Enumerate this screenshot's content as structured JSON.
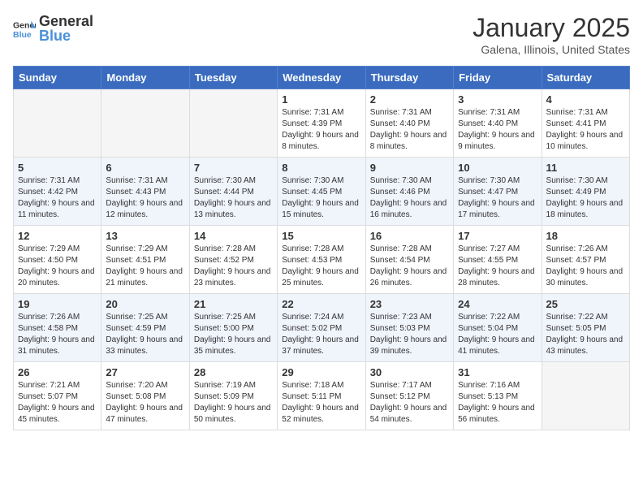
{
  "header": {
    "logo_general": "General",
    "logo_blue": "Blue",
    "month_title": "January 2025",
    "location": "Galena, Illinois, United States"
  },
  "weekdays": [
    "Sunday",
    "Monday",
    "Tuesday",
    "Wednesday",
    "Thursday",
    "Friday",
    "Saturday"
  ],
  "weeks": [
    [
      {
        "day": "",
        "info": ""
      },
      {
        "day": "",
        "info": ""
      },
      {
        "day": "",
        "info": ""
      },
      {
        "day": "1",
        "info": "Sunrise: 7:31 AM\nSunset: 4:39 PM\nDaylight: 9 hours and 8 minutes."
      },
      {
        "day": "2",
        "info": "Sunrise: 7:31 AM\nSunset: 4:40 PM\nDaylight: 9 hours and 8 minutes."
      },
      {
        "day": "3",
        "info": "Sunrise: 7:31 AM\nSunset: 4:40 PM\nDaylight: 9 hours and 9 minutes."
      },
      {
        "day": "4",
        "info": "Sunrise: 7:31 AM\nSunset: 4:41 PM\nDaylight: 9 hours and 10 minutes."
      }
    ],
    [
      {
        "day": "5",
        "info": "Sunrise: 7:31 AM\nSunset: 4:42 PM\nDaylight: 9 hours and 11 minutes."
      },
      {
        "day": "6",
        "info": "Sunrise: 7:31 AM\nSunset: 4:43 PM\nDaylight: 9 hours and 12 minutes."
      },
      {
        "day": "7",
        "info": "Sunrise: 7:30 AM\nSunset: 4:44 PM\nDaylight: 9 hours and 13 minutes."
      },
      {
        "day": "8",
        "info": "Sunrise: 7:30 AM\nSunset: 4:45 PM\nDaylight: 9 hours and 15 minutes."
      },
      {
        "day": "9",
        "info": "Sunrise: 7:30 AM\nSunset: 4:46 PM\nDaylight: 9 hours and 16 minutes."
      },
      {
        "day": "10",
        "info": "Sunrise: 7:30 AM\nSunset: 4:47 PM\nDaylight: 9 hours and 17 minutes."
      },
      {
        "day": "11",
        "info": "Sunrise: 7:30 AM\nSunset: 4:49 PM\nDaylight: 9 hours and 18 minutes."
      }
    ],
    [
      {
        "day": "12",
        "info": "Sunrise: 7:29 AM\nSunset: 4:50 PM\nDaylight: 9 hours and 20 minutes."
      },
      {
        "day": "13",
        "info": "Sunrise: 7:29 AM\nSunset: 4:51 PM\nDaylight: 9 hours and 21 minutes."
      },
      {
        "day": "14",
        "info": "Sunrise: 7:28 AM\nSunset: 4:52 PM\nDaylight: 9 hours and 23 minutes."
      },
      {
        "day": "15",
        "info": "Sunrise: 7:28 AM\nSunset: 4:53 PM\nDaylight: 9 hours and 25 minutes."
      },
      {
        "day": "16",
        "info": "Sunrise: 7:28 AM\nSunset: 4:54 PM\nDaylight: 9 hours and 26 minutes."
      },
      {
        "day": "17",
        "info": "Sunrise: 7:27 AM\nSunset: 4:55 PM\nDaylight: 9 hours and 28 minutes."
      },
      {
        "day": "18",
        "info": "Sunrise: 7:26 AM\nSunset: 4:57 PM\nDaylight: 9 hours and 30 minutes."
      }
    ],
    [
      {
        "day": "19",
        "info": "Sunrise: 7:26 AM\nSunset: 4:58 PM\nDaylight: 9 hours and 31 minutes."
      },
      {
        "day": "20",
        "info": "Sunrise: 7:25 AM\nSunset: 4:59 PM\nDaylight: 9 hours and 33 minutes."
      },
      {
        "day": "21",
        "info": "Sunrise: 7:25 AM\nSunset: 5:00 PM\nDaylight: 9 hours and 35 minutes."
      },
      {
        "day": "22",
        "info": "Sunrise: 7:24 AM\nSunset: 5:02 PM\nDaylight: 9 hours and 37 minutes."
      },
      {
        "day": "23",
        "info": "Sunrise: 7:23 AM\nSunset: 5:03 PM\nDaylight: 9 hours and 39 minutes."
      },
      {
        "day": "24",
        "info": "Sunrise: 7:22 AM\nSunset: 5:04 PM\nDaylight: 9 hours and 41 minutes."
      },
      {
        "day": "25",
        "info": "Sunrise: 7:22 AM\nSunset: 5:05 PM\nDaylight: 9 hours and 43 minutes."
      }
    ],
    [
      {
        "day": "26",
        "info": "Sunrise: 7:21 AM\nSunset: 5:07 PM\nDaylight: 9 hours and 45 minutes."
      },
      {
        "day": "27",
        "info": "Sunrise: 7:20 AM\nSunset: 5:08 PM\nDaylight: 9 hours and 47 minutes."
      },
      {
        "day": "28",
        "info": "Sunrise: 7:19 AM\nSunset: 5:09 PM\nDaylight: 9 hours and 50 minutes."
      },
      {
        "day": "29",
        "info": "Sunrise: 7:18 AM\nSunset: 5:11 PM\nDaylight: 9 hours and 52 minutes."
      },
      {
        "day": "30",
        "info": "Sunrise: 7:17 AM\nSunset: 5:12 PM\nDaylight: 9 hours and 54 minutes."
      },
      {
        "day": "31",
        "info": "Sunrise: 7:16 AM\nSunset: 5:13 PM\nDaylight: 9 hours and 56 minutes."
      },
      {
        "day": "",
        "info": ""
      }
    ]
  ]
}
